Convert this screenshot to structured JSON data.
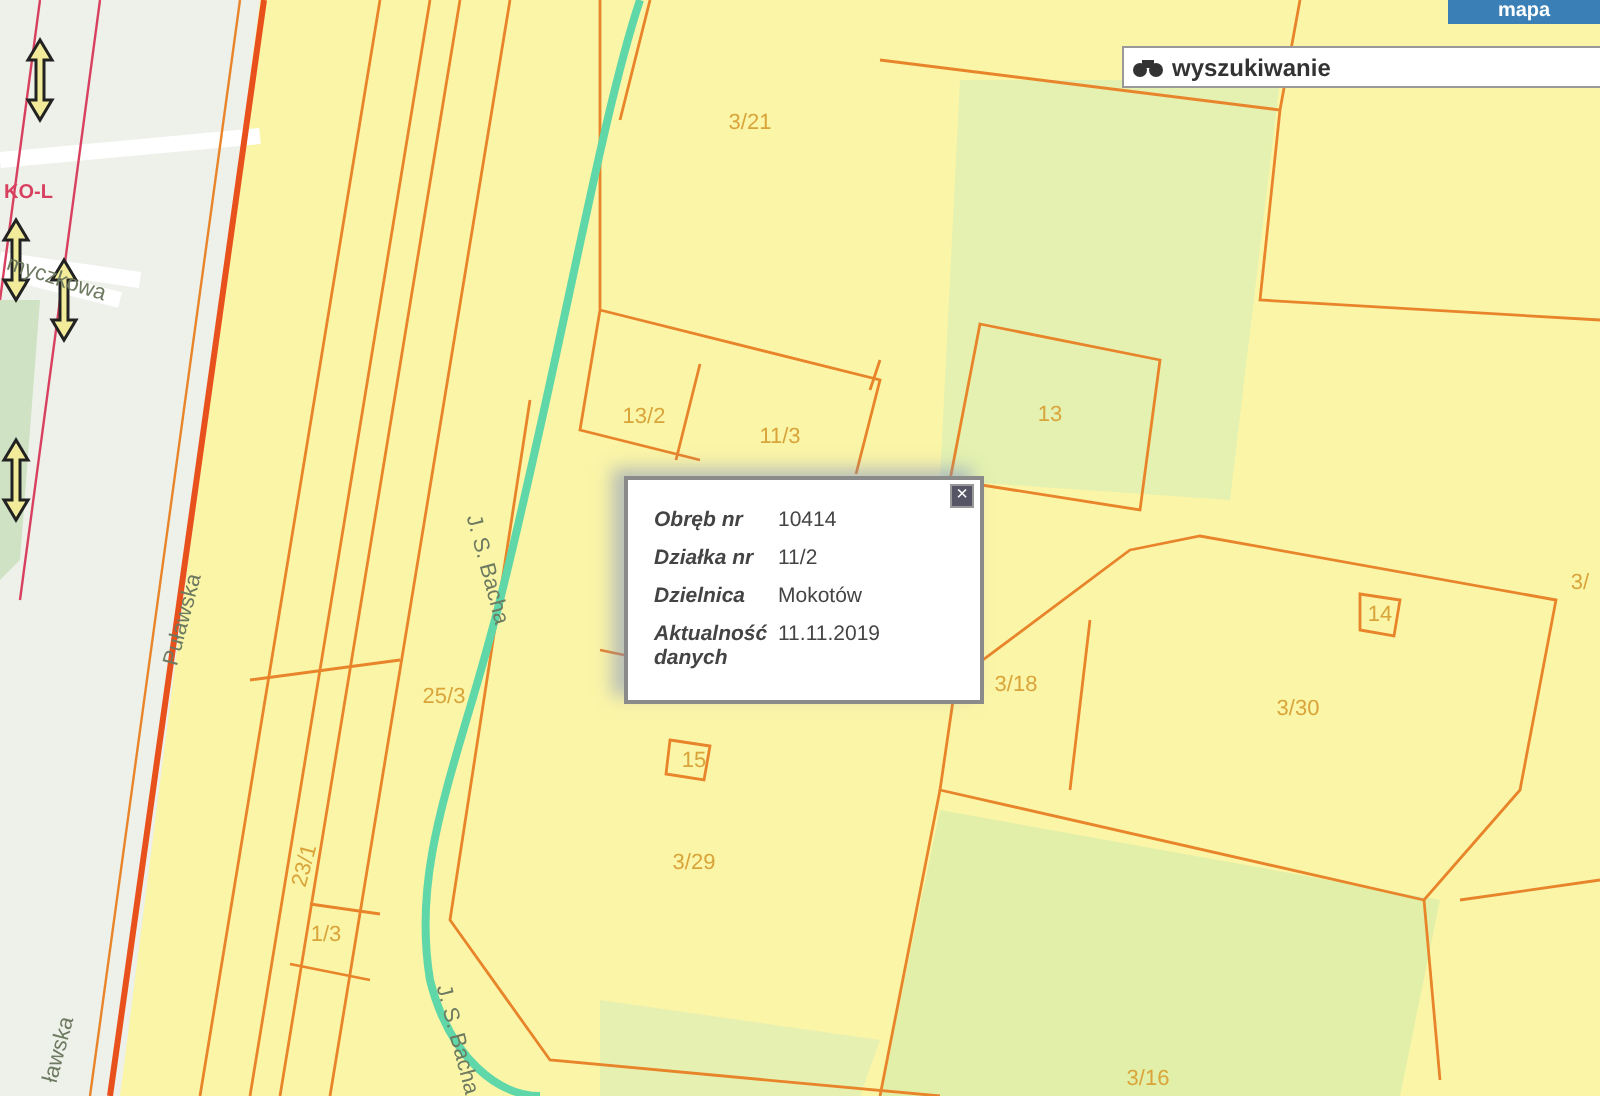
{
  "map": {
    "parcel_labels": [
      "3/21",
      "13/2",
      "11/3",
      "13",
      "14",
      "3/18",
      "3/30",
      "25/3",
      "15",
      "3/29",
      "23/1",
      "1/3",
      "3/16",
      "3/"
    ],
    "street_labels": [
      "Puławska",
      "ławska",
      "myczkowa",
      "J. S. Bacha",
      "J. S. Bacha"
    ],
    "route_label": "KO-L"
  },
  "search": {
    "label": "wyszukiwanie"
  },
  "map_tab": {
    "label": "mapa"
  },
  "popup": {
    "close": "×",
    "rows": [
      {
        "label": "Obręb nr",
        "value": "10414"
      },
      {
        "label": "Działka nr",
        "value": "11/2"
      },
      {
        "label": "Dzielnica",
        "value": "Mokotów"
      },
      {
        "label": "Aktualność danych",
        "value": "11.11.2019"
      }
    ]
  }
}
